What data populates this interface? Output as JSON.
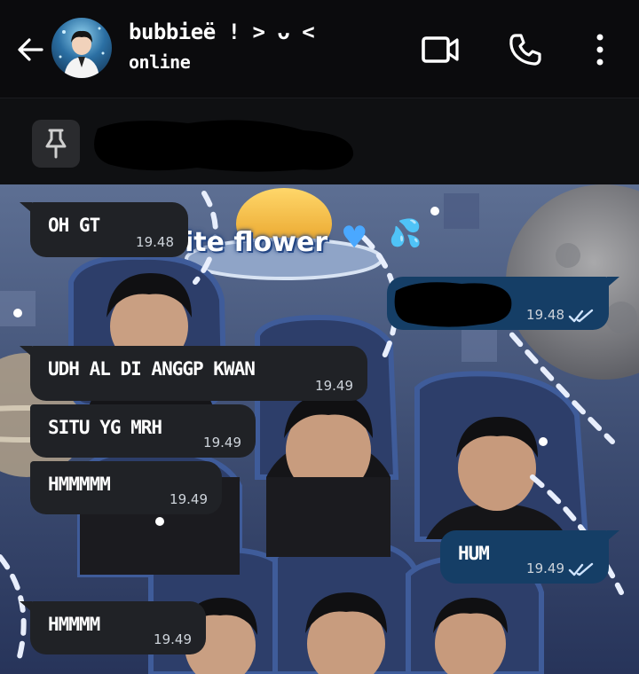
{
  "header": {
    "contact_name": "bubbieë ! > ᴗ <",
    "status": "online",
    "icons": [
      "back-arrow-icon",
      "video-camera-icon",
      "phone-icon",
      "more-vertical-icon"
    ]
  },
  "pinned": {
    "icon": "pin-icon",
    "text": ""
  },
  "wallpaper": {
    "caption": "ite flower",
    "heart": "♥",
    "drops": "💦"
  },
  "messages": [
    {
      "direction": "in",
      "text": "OH GT",
      "time": "19.48"
    },
    {
      "direction": "out",
      "text": "",
      "time": "19.48",
      "status": "read"
    },
    {
      "direction": "in",
      "text": "UDH AL DI ANGGP KWAN",
      "time": "19.49"
    },
    {
      "direction": "in",
      "text": "SITU YG MRH",
      "time": "19.49"
    },
    {
      "direction": "in",
      "text": "HMMMMM",
      "time": "19.49"
    },
    {
      "direction": "out",
      "text": "HUM",
      "time": "19.49",
      "status": "read"
    },
    {
      "direction": "in",
      "text": "HMMMM",
      "time": "19.49"
    }
  ],
  "colors": {
    "header_bg": "#0b0b0d",
    "incoming_bubble": "#202226",
    "outgoing_bubble": "#153e66",
    "read_tick": "#cfe4ff"
  }
}
